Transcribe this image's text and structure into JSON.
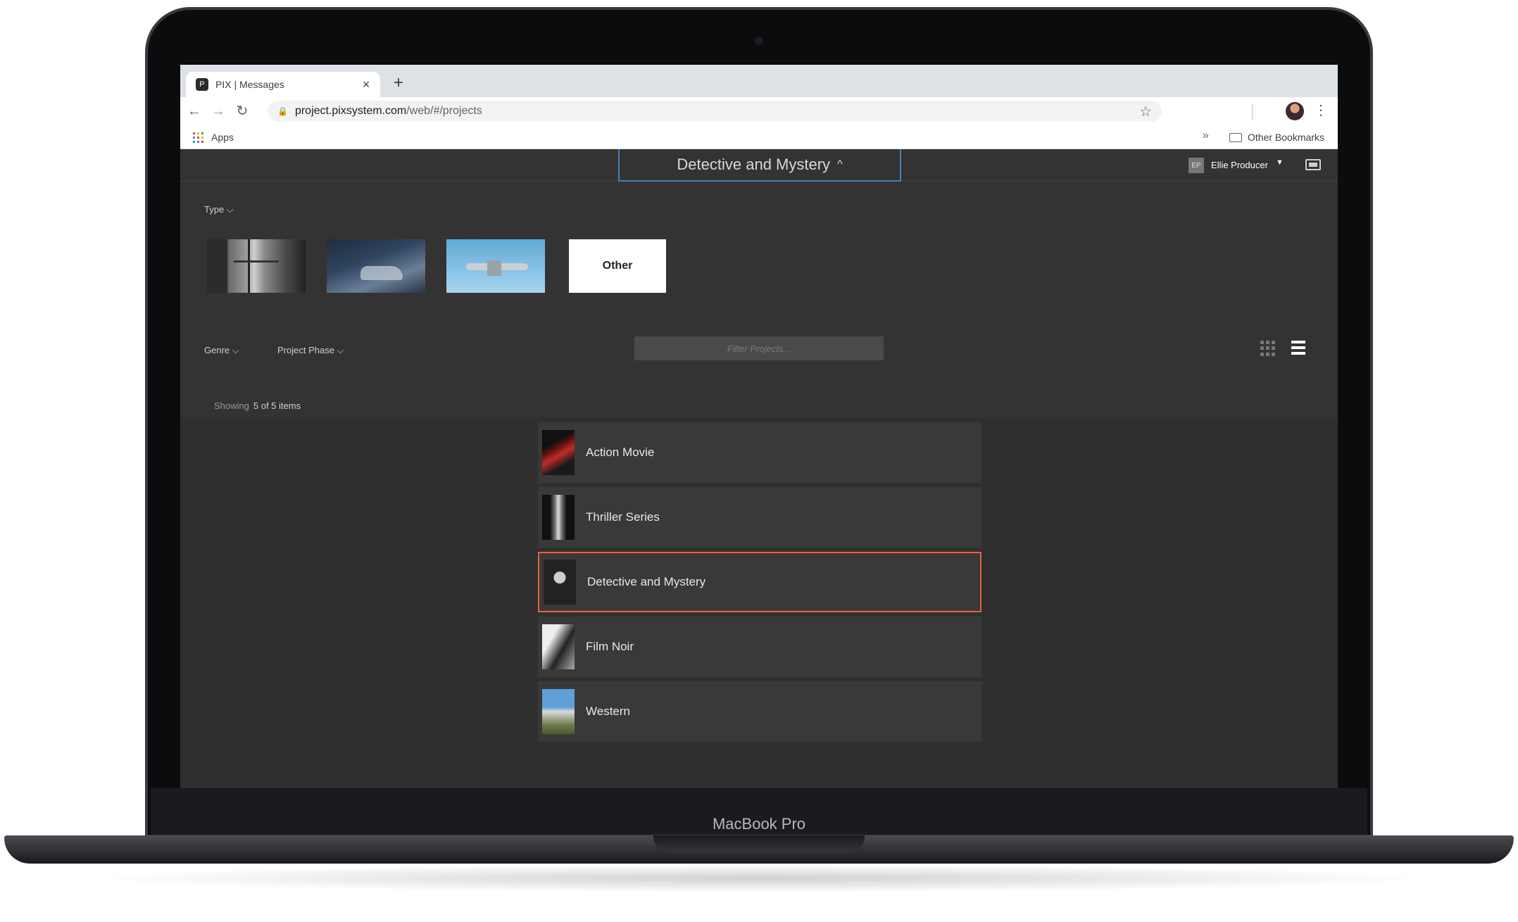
{
  "device": {
    "brand": "MacBook Pro"
  },
  "browser": {
    "tab_title": "PIX | Messages",
    "tab_favicon": "P",
    "close_label": "×",
    "new_tab_label": "+",
    "back_label": "←",
    "forward_label": "→",
    "reload_label": "↻",
    "lock_glyph": "🔒",
    "url_host": "project.pixsystem.com",
    "url_path": "/web/#/projects",
    "star_glyph": "☆",
    "menu_glyph": "⋮",
    "bookmarks": {
      "apps_label": "Apps",
      "more_label": "»",
      "other_label": "Other Bookmarks"
    }
  },
  "app": {
    "current_project": "Detective and Mystery",
    "selector_chevron": "^",
    "user": {
      "initials": "EP",
      "name": "Ellie Producer",
      "caret": "▼"
    },
    "filters": {
      "type_label": "Type ⌵",
      "genre_label": "Genre ⌵",
      "phase_label": "Project Phase ⌵",
      "search_placeholder": "Filter Projects..."
    },
    "type_tiles": [
      {
        "icon": "window-photo"
      },
      {
        "icon": "laptop-typing-photo"
      },
      {
        "icon": "airplane-photo"
      },
      {
        "label": "Other"
      }
    ],
    "showing": {
      "prefix": "Showing",
      "count": "5 of 5 items"
    },
    "projects": [
      {
        "title": "Action Movie",
        "thumb": "action-poster"
      },
      {
        "title": "Thriller Series",
        "thumb": "window-photo"
      },
      {
        "title": "Detective and Mystery",
        "thumb": "detective-photo",
        "selected": true
      },
      {
        "title": "Film Noir",
        "thumb": "bridge-photo"
      },
      {
        "title": "Western",
        "thumb": "horse-photo"
      }
    ],
    "colors": {
      "selected_border": "#e6623a",
      "selector_border": "#4a7fb8",
      "background": "#333333"
    }
  }
}
